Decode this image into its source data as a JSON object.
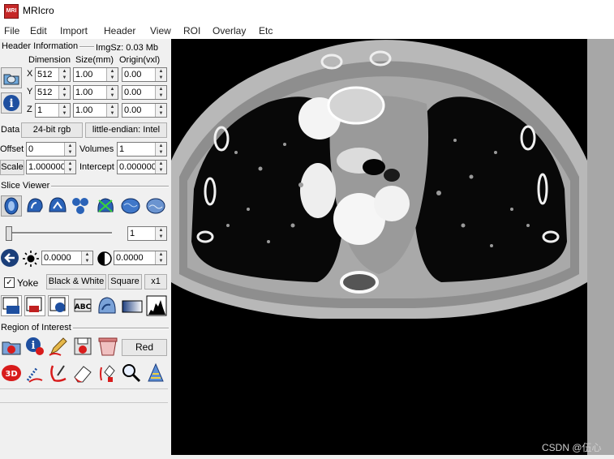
{
  "window": {
    "title": "MRIcro",
    "icon": "mricro-app-icon"
  },
  "menu": [
    "File",
    "Edit",
    "Import",
    "Header",
    "View",
    "ROI",
    "Overlay",
    "Etc"
  ],
  "header": {
    "section_title": "Header Information",
    "imgsz": "ImgSz: 0.03 Mb",
    "col_dimension": "Dimension",
    "col_size": "Size(mm)",
    "col_origin": "Origin(vxl)",
    "rows": [
      {
        "axis": "X",
        "dim": "512",
        "size": "1.00",
        "origin": "0.00"
      },
      {
        "axis": "Y",
        "dim": "512",
        "size": "1.00",
        "origin": "0.00"
      },
      {
        "axis": "Z",
        "dim": "1",
        "size": "1.00",
        "origin": "0.00"
      }
    ],
    "data_label": "Data",
    "data_type": "24-bit rgb",
    "endian": "little-endian: Intel",
    "offset_label": "Offset",
    "offset_value": "0",
    "volumes_label": "Volumes",
    "volumes_value": "1",
    "scale_label": "Scale",
    "scale_value": "1.000000",
    "intercept_label": "Intercept",
    "intercept_value": "0.000000"
  },
  "slice_viewer": {
    "section_title": "Slice Viewer",
    "icons": [
      "head-axial-icon",
      "head-sagittal-icon",
      "head-coronal-icon",
      "head-multiplanar-icon",
      "head-render-icon",
      "brain-left-icon",
      "brain-right-icon"
    ],
    "slice_value": "1",
    "slider_fraction": 0.0,
    "min_value": "0.0000",
    "max_value": "0.0000",
    "yoke_label": "Yoke",
    "yoke_checked": true,
    "colormap_button": "Black & White",
    "aspect_button": "Square",
    "zoom_button": "x1",
    "tool_icons": [
      "layout-1-icon",
      "layout-2-icon",
      "layout-3-icon",
      "abc-icon",
      "head-blend-icon",
      "gradient-icon",
      "histogram-icon"
    ]
  },
  "roi": {
    "section_title": "Region of Interest",
    "color_button": "Red",
    "row1_icons": [
      "roi-open-icon",
      "roi-info-icon",
      "pen-icon",
      "roi-save-icon",
      "trash-icon"
    ],
    "row2_icons": [
      "3d-icon",
      "dotted-pen-icon",
      "freehand-pen-icon",
      "eraser-icon",
      "fill-icon",
      "magnifier-icon",
      "cone-icon"
    ]
  },
  "watermark": "CSDN @伍心"
}
